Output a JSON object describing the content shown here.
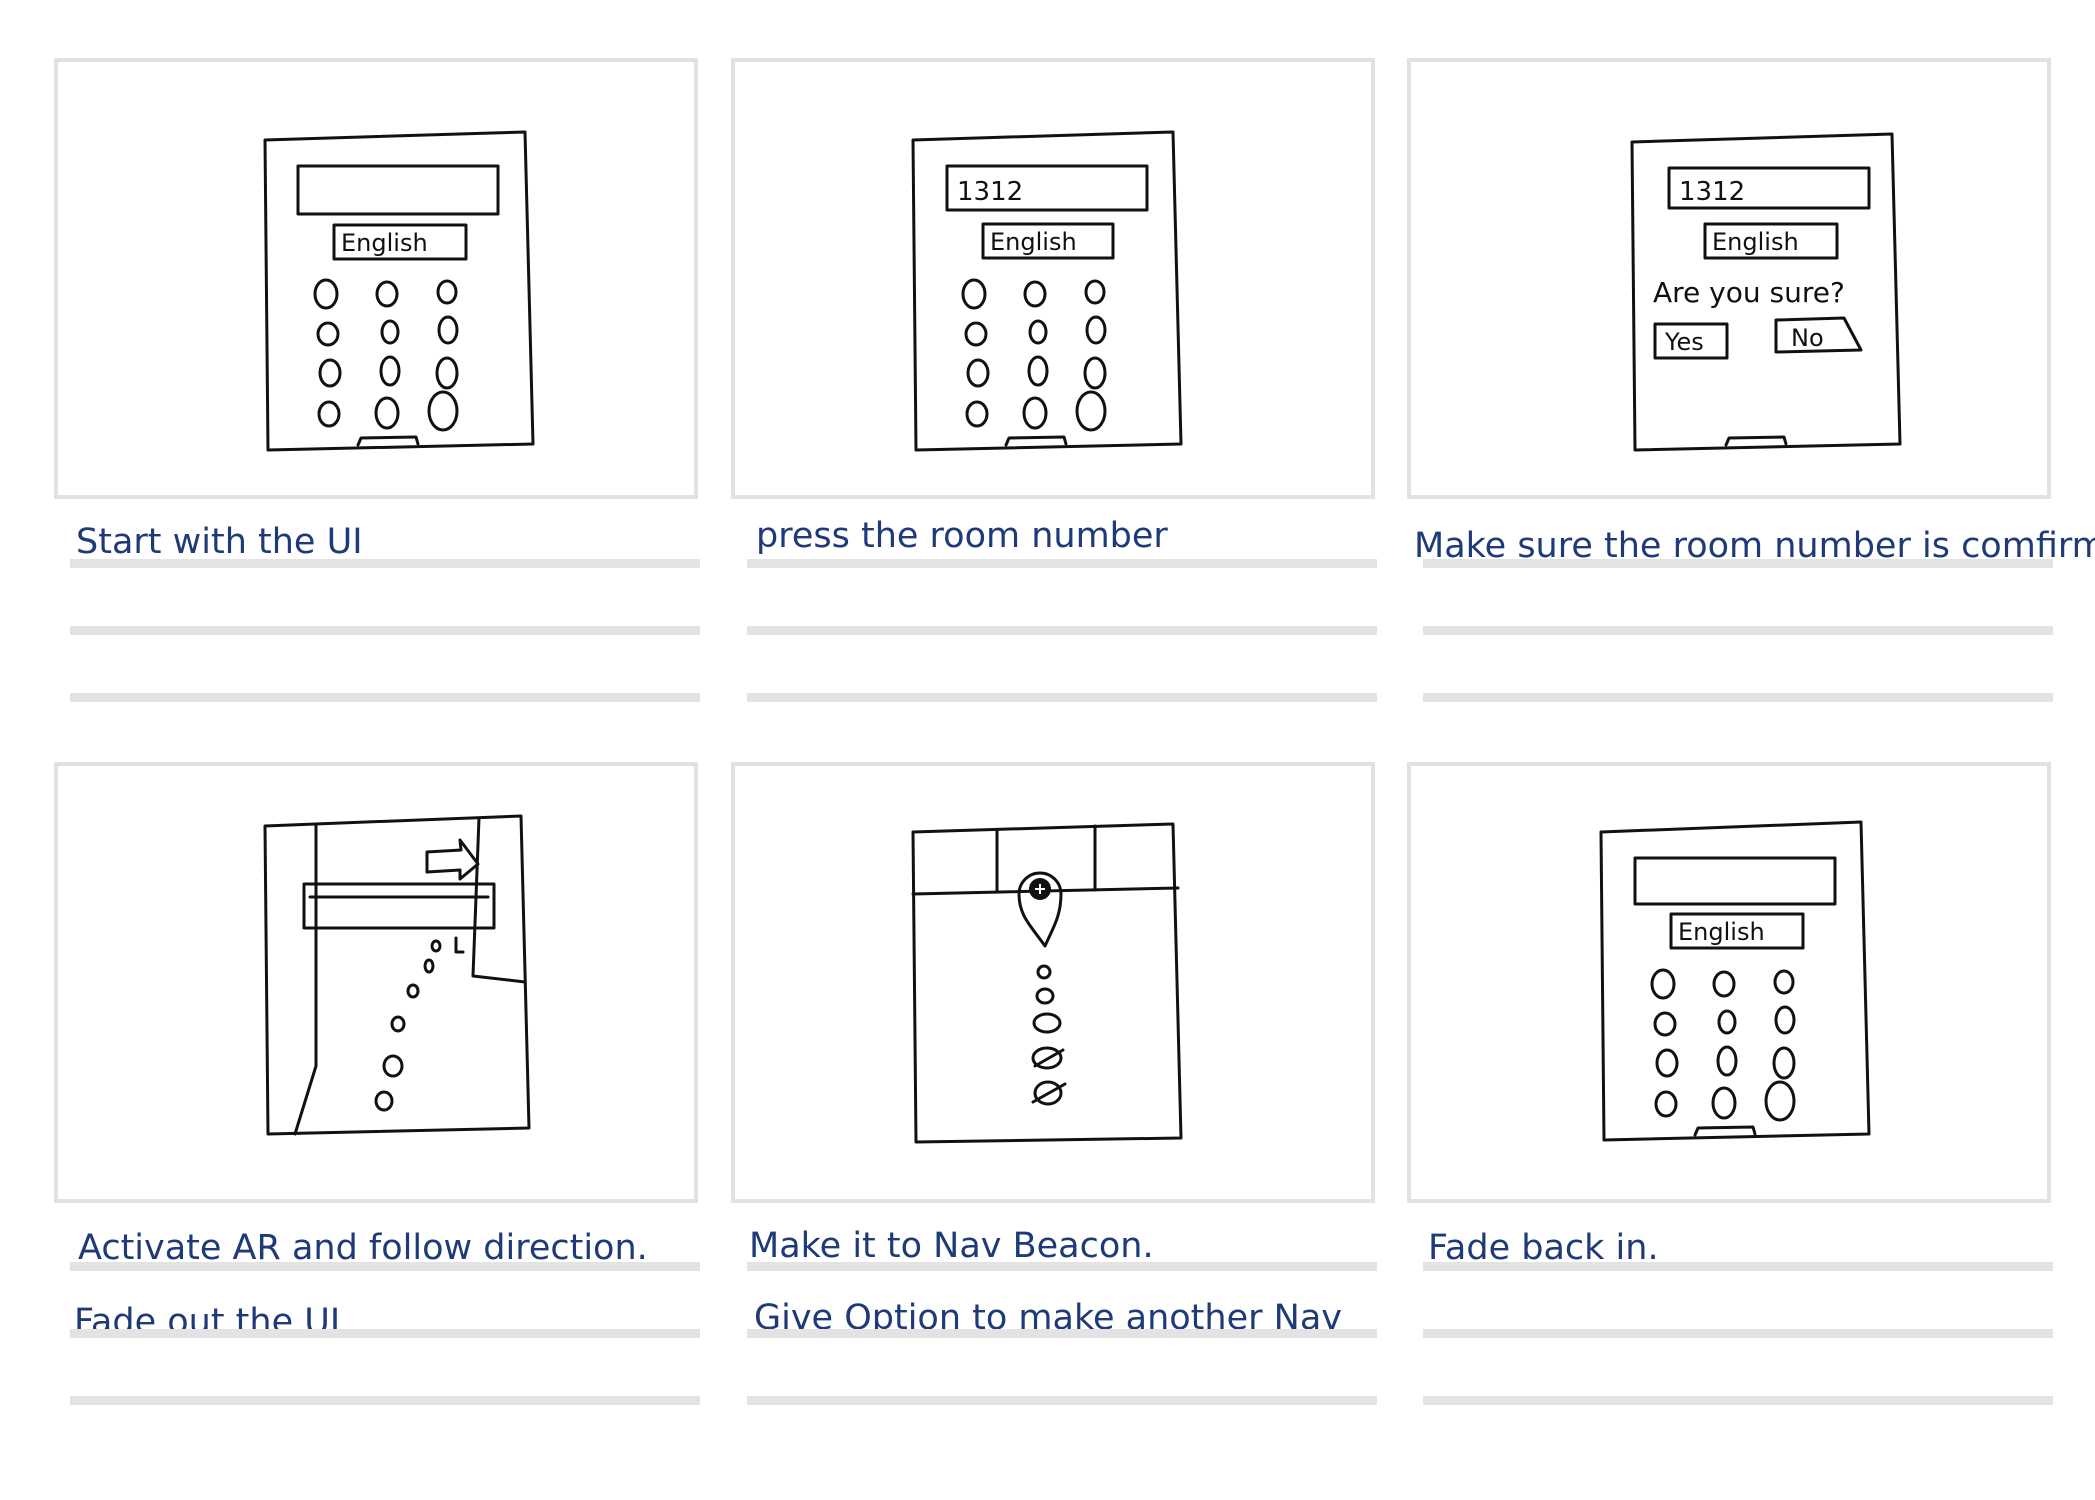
{
  "storyboard": {
    "frames": [
      {
        "id": "f1",
        "screen": {
          "room_number": "",
          "language": "English"
        },
        "captions": [
          "Start with the UI"
        ]
      },
      {
        "id": "f2",
        "screen": {
          "room_number": "1312",
          "language": "English"
        },
        "captions": [
          "press the room number"
        ]
      },
      {
        "id": "f3",
        "screen": {
          "room_number": "1312",
          "language": "English",
          "prompt": "Are you sure?",
          "yes_label": "Yes",
          "no_label": "No"
        },
        "captions": [
          "Make sure the room number is comfirm."
        ]
      },
      {
        "id": "f4",
        "captions": [
          "Activate AR and follow direction.",
          "Fade out the UI"
        ]
      },
      {
        "id": "f5",
        "captions": [
          "Make it to Nav Beacon.",
          "Give Option to make another Nav"
        ]
      },
      {
        "id": "f6",
        "screen": {
          "room_number": "",
          "language": "English"
        },
        "captions": [
          "Fade back in."
        ]
      }
    ]
  },
  "colors": {
    "caption": "#1f3a78",
    "panel_border": "#e2e2e2",
    "rule": "#e3e3e3",
    "ink": "#111111"
  },
  "icons": [
    "arrow-right-icon",
    "footprints-icon",
    "location-pin-icon"
  ]
}
